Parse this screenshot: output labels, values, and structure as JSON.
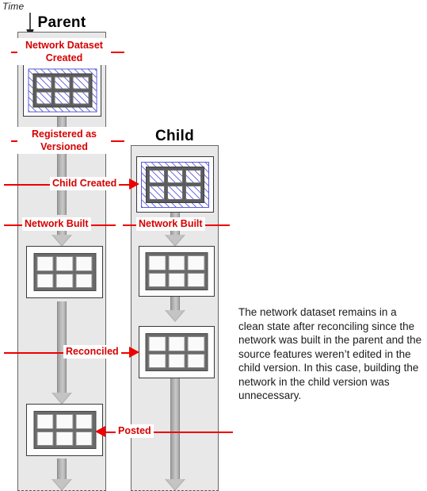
{
  "diagram": {
    "time_axis": {
      "label": "Time",
      "icon": "down-arrow-icon"
    },
    "lanes": [
      {
        "id": "parent",
        "title": "Parent"
      },
      {
        "id": "child",
        "title": "Child"
      }
    ],
    "events": [
      {
        "id": "network-dataset-created",
        "label": "Network Dataset Created",
        "lane": "parent",
        "direction": "none"
      },
      {
        "id": "registered-as-versioned",
        "label": "Registered as Versioned",
        "lane": "parent",
        "direction": "none"
      },
      {
        "id": "child-created",
        "label": "Child Created",
        "lane": "parent-to-child",
        "direction": "right"
      },
      {
        "id": "network-built-parent",
        "label": "Network Built",
        "lane": "parent",
        "direction": "none"
      },
      {
        "id": "network-built-child",
        "label": "Network Built",
        "lane": "child",
        "direction": "none"
      },
      {
        "id": "reconciled",
        "label": "Reconciled",
        "lane": "parent-to-child",
        "direction": "right"
      },
      {
        "id": "posted",
        "label": "Posted",
        "lane": "child-to-parent",
        "direction": "left"
      }
    ],
    "nodes": [
      {
        "id": "parent-dataset-versioned",
        "lane": "parent",
        "state": "hatched",
        "rows": 2,
        "cols": 3
      },
      {
        "id": "parent-network-built",
        "lane": "parent",
        "state": "clean",
        "rows": 2,
        "cols": 3
      },
      {
        "id": "parent-posted",
        "lane": "parent",
        "state": "clean",
        "rows": 2,
        "cols": 3
      },
      {
        "id": "child-created-dataset",
        "lane": "child",
        "state": "hatched",
        "rows": 2,
        "cols": 3
      },
      {
        "id": "child-network-built",
        "lane": "child",
        "state": "clean",
        "rows": 2,
        "cols": 3
      },
      {
        "id": "child-reconciled",
        "lane": "child",
        "state": "clean",
        "rows": 2,
        "cols": 3
      }
    ],
    "note": "The network dataset remains in a clean state after reconciling since the network was built in the parent and the source features weren’t edited in the child version. In this case, building the network in the child version was unnecessary.",
    "colors": {
      "event_red": "#ee0000",
      "lane_fill": "#e8e8e8",
      "flow_gray": "#b5b5b5",
      "hatch_blue": "#5b5bd6",
      "grid_line": "#6a6a6a"
    }
  }
}
